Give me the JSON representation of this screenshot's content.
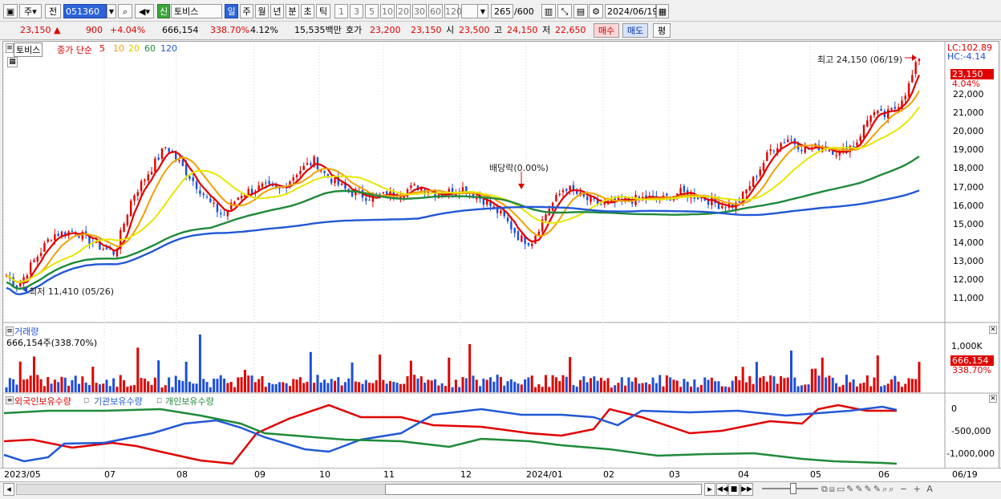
{
  "toolbar": {
    "period_unit": "주",
    "prev_label": "전",
    "code": "051360",
    "market_badge": "신",
    "stock_name": "토비스",
    "period_tabs": [
      "일",
      "주",
      "월",
      "년",
      "분",
      "초",
      "틱"
    ],
    "interval_buttons": [
      "1",
      "3",
      "5",
      "10",
      "20",
      "30",
      "60",
      "120"
    ],
    "count_value": "265",
    "count_total": "/600",
    "date": "2024/06/19"
  },
  "quote": {
    "price": "23,150",
    "arrow": "▲",
    "change": "900",
    "change_pct": "+4.04%",
    "volume": "666,154",
    "volume_ratio": "338.70%",
    "turnover": "4.12%",
    "amount": "15,535백만",
    "hoga_label": "호가",
    "ask": "23,200",
    "bid": "23,150",
    "open_label": "시",
    "open": "23,500",
    "high_label": "고",
    "high": "24,150",
    "low_label": "저",
    "low": "22,650",
    "buy_label": "매수",
    "sell_label": "매도",
    "eval_label": "평"
  },
  "price_panel": {
    "name_tag": "토비스",
    "ma_title": "종가 단순",
    "ma_periods": [
      "5",
      "10",
      "20",
      "60",
      "120"
    ],
    "ma_colors": [
      "#e00000",
      "#f0a000",
      "#e6e600",
      "#1f8a3a",
      "#2158d6"
    ],
    "high_note": "최고 24,150 (06/19)",
    "low_note": "최저 11,410 (05/26)",
    "dividend_note": "배당락(0.00%)",
    "lc": "LC:102.89",
    "hc": "HC:-4.14",
    "last_price_tag": "23,150",
    "last_pct_tag": "4.04%",
    "y_ticks": [
      "22,000",
      "21,000",
      "20,000",
      "19,000",
      "18,000",
      "17,000",
      "16,000",
      "15,000",
      "14,000",
      "13,000",
      "12,000",
      "11,000"
    ]
  },
  "volume_panel": {
    "title": "거래량",
    "value_line": "666,154주(338.70%)",
    "y_tick": "1,000K",
    "last_tag": "666,154",
    "last_pct": "338.70%"
  },
  "holding_panel": {
    "legends": [
      "외국인보유수량",
      "기관보유수량",
      "개인보유수량"
    ],
    "legend_colors": [
      "#e00000",
      "#2158d6",
      "#1f8a3a"
    ],
    "y_ticks": [
      "0",
      "-500,000",
      "-1,000,000"
    ]
  },
  "x_axis": {
    "labels": [
      "2023/05",
      "07",
      "08",
      "09",
      "10",
      "11",
      "12",
      "2024/01",
      "02",
      "03",
      "04",
      "05",
      "06"
    ],
    "right_label": "06/19"
  }
}
